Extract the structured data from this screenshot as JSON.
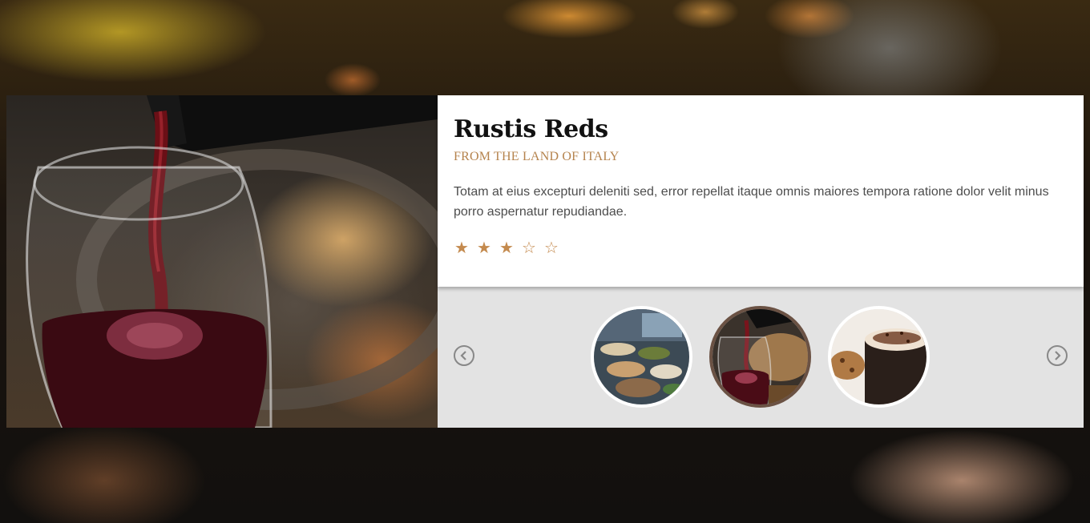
{
  "product": {
    "title": "Rustis Reds",
    "subtitle": "FROM THE LAND OF ITALY",
    "description": "Totam at eius excepturi deleniti sed, error repellat itaque omnis maiores tempora ratione dolor velit minus porro aspernatur repudiandae.",
    "rating": 3,
    "rating_max": 5,
    "stars": [
      "★",
      "★",
      "★",
      "☆",
      "☆"
    ]
  },
  "gallery": {
    "thumbnails": [
      {
        "name": "buffet-thumbnail",
        "active": false
      },
      {
        "name": "wine-pour-thumbnail",
        "active": true
      },
      {
        "name": "coffee-thumbnail",
        "active": false
      }
    ],
    "prev_icon": "chevron-left-circle-icon",
    "next_icon": "chevron-right-circle-icon"
  },
  "colors": {
    "accent": "#b5834d",
    "star": "#c48a4e",
    "active_thumb_border": "#6b5244",
    "gallery_bg": "#e3e3e3"
  }
}
